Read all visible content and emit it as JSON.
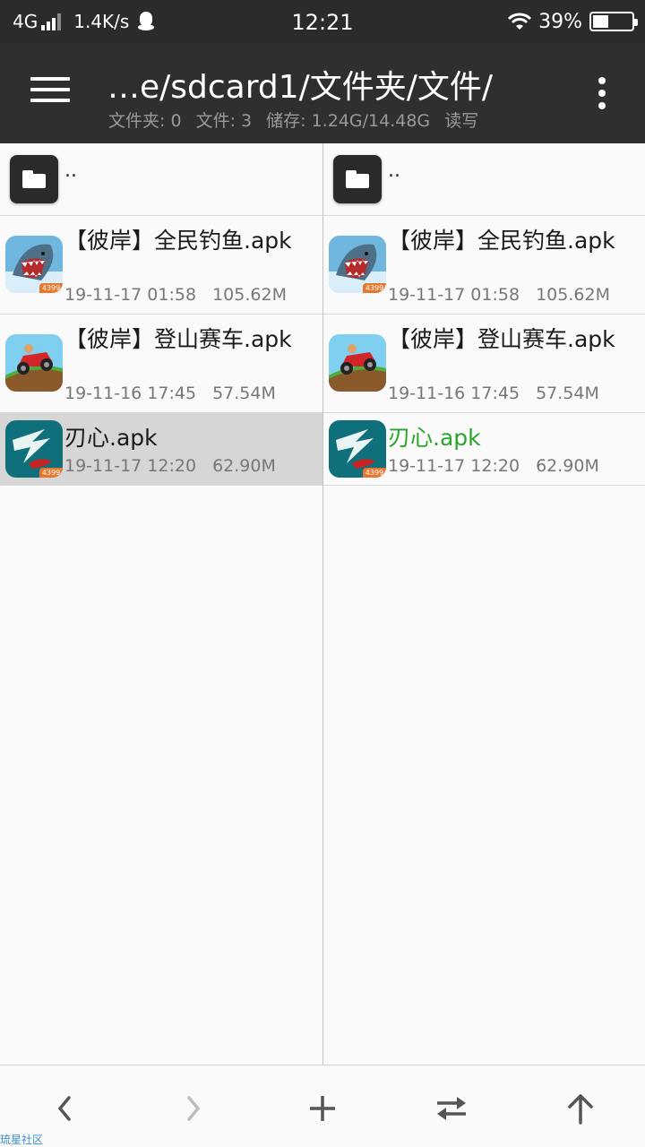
{
  "status_bar": {
    "network": "4G",
    "speed": "1.4K/s",
    "time": "12:21",
    "battery": "39%"
  },
  "toolbar": {
    "path": "…e/sdcard1/文件夹/文件/",
    "folders": "文件夹: 0",
    "files": "文件: 3",
    "storage": "储存: 1.24G/14.48G",
    "access": "读写"
  },
  "left_panel": {
    "parent_label": "..",
    "items": [
      {
        "name": "【彼岸】全民钓鱼.apk",
        "date": "19-11-17 01:58",
        "size": "105.62M",
        "icon": "shark-game-icon"
      },
      {
        "name": "【彼岸】登山赛车.apk",
        "date": "19-11-16 17:45",
        "size": "57.54M",
        "icon": "hill-climb-car-icon"
      },
      {
        "name": "刃心.apk",
        "date": "19-11-17 12:20",
        "size": "62.90M",
        "icon": "blade-heart-icon"
      }
    ]
  },
  "right_panel": {
    "parent_label": "..",
    "items": [
      {
        "name": "【彼岸】全民钓鱼.apk",
        "date": "19-11-17 01:58",
        "size": "105.62M",
        "icon": "shark-game-icon"
      },
      {
        "name": "【彼岸】登山赛车.apk",
        "date": "19-11-16 17:45",
        "size": "57.54M",
        "icon": "hill-climb-car-icon"
      },
      {
        "name": "刃心.apk",
        "date": "19-11-17 12:20",
        "size": "62.90M",
        "icon": "blade-heart-icon"
      }
    ]
  },
  "badge_text": "4399",
  "watermark": "琉星社区",
  "colors": {
    "toolbar_bg": "#2f2f2f",
    "status_bg": "#2b2b2b",
    "selected_row": "#d6d6d6",
    "highlight_green": "#2aa52a"
  }
}
